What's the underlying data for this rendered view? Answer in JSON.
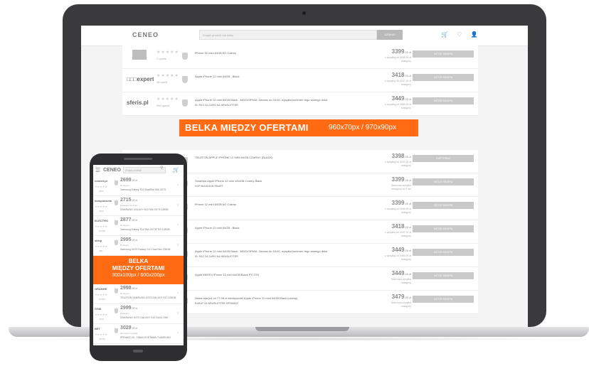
{
  "desktop": {
    "logo": "CENEO",
    "search_placeholder": "Znajdz produkt lub sklep",
    "search_button": "SZUKAJ",
    "header_icons": "🛒 ♡ 👤",
    "rows_top": [
      {
        "shop": "",
        "shop_box": true,
        "stars": "★★★★★",
        "ops": "2 opinie",
        "product": "iPhone 12 mini 64GB 5G Czarny",
        "note": "",
        "price": "3399",
        "cents": ",00 zł",
        "ship": "z wysyłką od 3408,99 zł|dostępny",
        "button": "IDŹ DO SKLEPU"
      },
      {
        "shop": "□□□expert",
        "shop_box": false,
        "stars": "★★★★★",
        "ops": "48 opinii",
        "product": "Apple iPhone 12 mini 64GB - Black",
        "note": "",
        "price": "3418",
        "cents": ",00 zł",
        "ship": "z wysyłką od 3437,00 zł|dostępny",
        "button": "IDŹ DO SKLEPU"
      },
      {
        "shop": "sferis.pl",
        "shop_box": false,
        "stars": "★★★★★",
        "ops": "264 opinie",
        "product": "Apple iPhone 12 mini 64GB Black - MGDX3PM/A. Zamów do 16:00, wysyłka kurierem tego samego dnia!",
        "note": "ID: RAZ ZA ZAPIS NA NEWSLETTER",
        "price": "3449",
        "cents": ",00 zł",
        "ship": "z wysyłką od 3459,00 zł|dostępny",
        "button": "IDŹ DO SKLEPU"
      }
    ],
    "banner_main": "BELKA MIĘDZY OFERTAMI",
    "banner_sub": "960x70px / 970x90px",
    "rows_bottom": [
      {
        "shop": "",
        "shop_box": true,
        "stars": "★★★★★",
        "ops": "",
        "product": "TELEFON APPLE IPHONE 12 MINI 64GB CZARNY (BLACK)",
        "note": "",
        "price": "3398",
        "cents": ",00 zł",
        "ship": "z wysyłką od 3407,00 zł|dostępny",
        "button": "KUP TERAZ"
      },
      {
        "shop": "",
        "shop_box": false,
        "stars": "",
        "ops": "",
        "product": "Smartfon Apple iPhone 12 mini 4/64GB Czarny Black",
        "note": "KUP MIAUDIOM SMART",
        "price": "3399",
        "cents": ",00 zł",
        "ship": "Darmowa wysyłka|dostępny do 3 dni",
        "button": "IDŹ DO SKLEPU"
      },
      {
        "shop": "",
        "shop_box": false,
        "stars": "",
        "ops": "",
        "product": "iPhone 12 mini 64GB 5G Czarny",
        "note": "",
        "price": "3399",
        "cents": ",00 zł",
        "ship": "z wysyłką od 3408,99 zł|dostępny",
        "button": "IDŹ DO SKLEPU"
      },
      {
        "shop": "",
        "shop_box": false,
        "stars": "",
        "ops": "",
        "product": "Apple iPhone 12 mini 64GB - Black",
        "note": "",
        "price": "3418",
        "cents": ",00 zł",
        "ship": "z wysyłką od 3437,00 zł|dostępny",
        "button": "IDŹ DO SKLEPU"
      },
      {
        "shop": "",
        "shop_box": false,
        "stars": "",
        "ops": "",
        "product": "Apple iPhone 12 mini 64GB Black - MGDX3PM/A. Zamów do 16:00, wysyłka kurierem tego samego dnia!",
        "note": "ID: RAZ ZA ZAPIS NA NEWSLETTER",
        "price": "3449",
        "cents": ",00 zł",
        "ship": "z wysyłką od 3459,00 zł|dostępny",
        "button": "IDŹ DO SKLEPU"
      },
      {
        "shop": "",
        "shop_box": false,
        "stars": "",
        "ops": "",
        "product": "Apple MKEE4 iPhone 12 mini 64GB Black PV 23%",
        "note": "",
        "price": "3449",
        "cents": ",00 zł",
        "ship": "Darmowa wysyłka|dostępny",
        "button": "IDŹ DO SKLEPU"
      },
      {
        "shop": "",
        "shop_box": false,
        "stars": "",
        "ops": "",
        "product": "Niska rata już od 77,98 zł miesięcznie! Apple iPhone 12 mini 64GB Black (czarny)",
        "note": "RABAT ZA NEWSLETTER SPRAWDŹ",
        "price": "3479",
        "cents": ",00 zł",
        "ship": "Darmowa wysyłka|dostępny",
        "button": "IDŹ DO SKLEPU"
      }
    ]
  },
  "mobile": {
    "logo": "CENEO",
    "search_placeholder": "Znajdz produkt",
    "rows_top": [
      {
        "shop": "neonet.pl",
        "stars": "★★★★★",
        "ops": "(956)",
        "price": "2699",
        "cents": ",00 zł",
        "ship": "Dostępny",
        "product": "Samsung Galaxy S10 DualSim SM-G973"
      },
      {
        "shop": "komputronik",
        "stars": "★★★★★",
        "ops": "(461)",
        "price": "2715",
        "cents": ",00 zł",
        "ship": "Dostępny do 3 dni",
        "product": "SAMSUNG GALAXY S10 SM-G973 128GB"
      },
      {
        "shop": "ELECTRO",
        "stars": "★★★★★",
        "ops": "(1708)",
        "price": "2877",
        "cents": ",00 zł",
        "ship": "Dostępny",
        "product": "Samsung Galaxy S10 SM-G973F DS 128GB"
      },
      {
        "shop": "sklep",
        "stars": "★★★★★",
        "ops": "(28)",
        "price": "2995",
        "cents": ",00 zł",
        "ship": "Dostępny",
        "product": "Samsung G973 Galaxy S10 Dual Sim 128GB"
      }
    ],
    "banner_line1": "BELKA",
    "banner_line2": "MIĘDZY OFERTAMI",
    "banner_line3": "300x100px / 600x200px",
    "rows_bottom": [
      {
        "shop": "ORANGE",
        "stars": "★★★★★",
        "ops": "(2765)",
        "price": "2998",
        "cents": ",00 zł",
        "ship": "Dostępny",
        "product": "TELEFON SAMSUNG G973 GALAXY S10 128GB"
      },
      {
        "shop": "GSM",
        "stars": "★★★★★",
        "ops": "(393)",
        "price": "2999",
        "cents": ",00 zł",
        "ship": "Dostępny",
        "product": "SAMSUNG G973 GALAXY S10 DUAL SIM"
      },
      {
        "shop": "BET",
        "stars": "★★★★★",
        "ops": "(2076)",
        "price": "3029",
        "cents": ",00 zł",
        "ship": "Darmowa wysyłka",
        "product": "PROMOCJA - TANIA DOSTAWA / SAMSUNG"
      }
    ]
  }
}
